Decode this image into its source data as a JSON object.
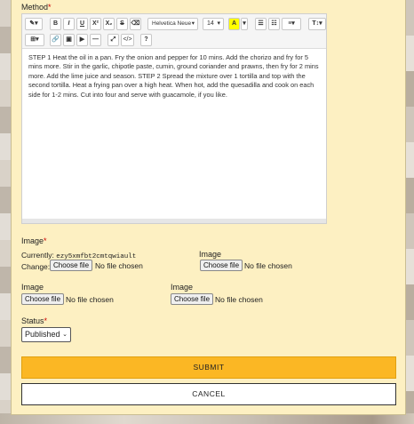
{
  "method": {
    "label": "Method",
    "required_mark": "*",
    "toolbar": {
      "magic": "✎▾",
      "bold": "B",
      "italic": "I",
      "underline": "U",
      "superscript": "X²",
      "subscript": "X₂",
      "strikethrough": "S",
      "eraser": "⌫",
      "font_name": "Helvetica Neue",
      "font_size": "14",
      "color": "A",
      "color_caret": "▾",
      "ul": "☰",
      "ol": "☷",
      "align": "≡▾",
      "line_height": "T↕▾",
      "table": "⊞▾",
      "link": "🔗",
      "picture": "▣",
      "video": "▶",
      "hr": "—",
      "fullscreen": "⤢",
      "code": "</>",
      "help": "?"
    },
    "text": "STEP 1 Heat the oil in a pan. Fry the onion and pepper for 10 mins. Add the chorizo and fry for 5 mins more. Stir in the garlic, chipotle paste, cumin, ground coriander and prawns, then fry for 2 mins more. Add the lime juice and season. STEP 2 Spread the mixture over 1 tortilla and top with the second tortilla. Heat a frying pan over a high heat. When hot, add the quesadilla and cook on each side for 1-2 mins. Cut into four and serve with guacamole, if you like."
  },
  "images": {
    "main": {
      "label": "Image",
      "required_mark": "*",
      "currently_label": "Currently:",
      "currently_value": "ezy5xmfbt2cmtqwiault",
      "change_label": "Change:",
      "button": "Choose file",
      "status": "No file chosen"
    },
    "image2": {
      "label": "Image",
      "button": "Choose file",
      "status": "No file chosen"
    },
    "image3": {
      "label": "Image",
      "button": "Choose file",
      "status": "No file chosen"
    },
    "image4": {
      "label": "Image",
      "button": "Choose file",
      "status": "No file chosen"
    }
  },
  "status": {
    "label": "Status",
    "required_mark": "*",
    "selected": "Published"
  },
  "actions": {
    "submit": "SUBMIT",
    "cancel": "CANCEL"
  },
  "colors": {
    "panel": "#fdf0c2",
    "submit": "#fbb724",
    "required": "#cc0000"
  }
}
